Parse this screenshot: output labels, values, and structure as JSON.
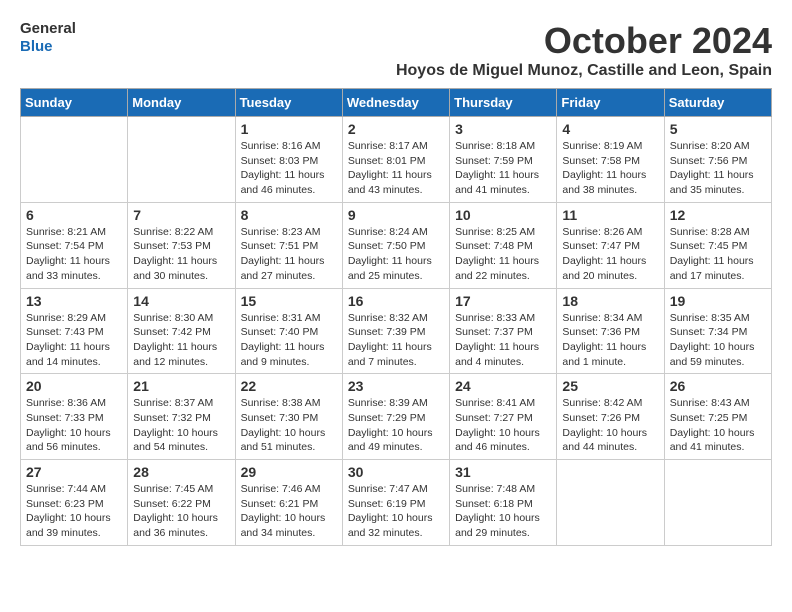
{
  "header": {
    "logo": {
      "line1": "General",
      "line2": "Blue"
    },
    "month_title": "October 2024",
    "subtitle": "Hoyos de Miguel Munoz, Castille and Leon, Spain"
  },
  "weekdays": [
    "Sunday",
    "Monday",
    "Tuesday",
    "Wednesday",
    "Thursday",
    "Friday",
    "Saturday"
  ],
  "weeks": [
    [
      {
        "day": "",
        "info": ""
      },
      {
        "day": "",
        "info": ""
      },
      {
        "day": "1",
        "info": "Sunrise: 8:16 AM\nSunset: 8:03 PM\nDaylight: 11 hours and 46 minutes."
      },
      {
        "day": "2",
        "info": "Sunrise: 8:17 AM\nSunset: 8:01 PM\nDaylight: 11 hours and 43 minutes."
      },
      {
        "day": "3",
        "info": "Sunrise: 8:18 AM\nSunset: 7:59 PM\nDaylight: 11 hours and 41 minutes."
      },
      {
        "day": "4",
        "info": "Sunrise: 8:19 AM\nSunset: 7:58 PM\nDaylight: 11 hours and 38 minutes."
      },
      {
        "day": "5",
        "info": "Sunrise: 8:20 AM\nSunset: 7:56 PM\nDaylight: 11 hours and 35 minutes."
      }
    ],
    [
      {
        "day": "6",
        "info": "Sunrise: 8:21 AM\nSunset: 7:54 PM\nDaylight: 11 hours and 33 minutes."
      },
      {
        "day": "7",
        "info": "Sunrise: 8:22 AM\nSunset: 7:53 PM\nDaylight: 11 hours and 30 minutes."
      },
      {
        "day": "8",
        "info": "Sunrise: 8:23 AM\nSunset: 7:51 PM\nDaylight: 11 hours and 27 minutes."
      },
      {
        "day": "9",
        "info": "Sunrise: 8:24 AM\nSunset: 7:50 PM\nDaylight: 11 hours and 25 minutes."
      },
      {
        "day": "10",
        "info": "Sunrise: 8:25 AM\nSunset: 7:48 PM\nDaylight: 11 hours and 22 minutes."
      },
      {
        "day": "11",
        "info": "Sunrise: 8:26 AM\nSunset: 7:47 PM\nDaylight: 11 hours and 20 minutes."
      },
      {
        "day": "12",
        "info": "Sunrise: 8:28 AM\nSunset: 7:45 PM\nDaylight: 11 hours and 17 minutes."
      }
    ],
    [
      {
        "day": "13",
        "info": "Sunrise: 8:29 AM\nSunset: 7:43 PM\nDaylight: 11 hours and 14 minutes."
      },
      {
        "day": "14",
        "info": "Sunrise: 8:30 AM\nSunset: 7:42 PM\nDaylight: 11 hours and 12 minutes."
      },
      {
        "day": "15",
        "info": "Sunrise: 8:31 AM\nSunset: 7:40 PM\nDaylight: 11 hours and 9 minutes."
      },
      {
        "day": "16",
        "info": "Sunrise: 8:32 AM\nSunset: 7:39 PM\nDaylight: 11 hours and 7 minutes."
      },
      {
        "day": "17",
        "info": "Sunrise: 8:33 AM\nSunset: 7:37 PM\nDaylight: 11 hours and 4 minutes."
      },
      {
        "day": "18",
        "info": "Sunrise: 8:34 AM\nSunset: 7:36 PM\nDaylight: 11 hours and 1 minute."
      },
      {
        "day": "19",
        "info": "Sunrise: 8:35 AM\nSunset: 7:34 PM\nDaylight: 10 hours and 59 minutes."
      }
    ],
    [
      {
        "day": "20",
        "info": "Sunrise: 8:36 AM\nSunset: 7:33 PM\nDaylight: 10 hours and 56 minutes."
      },
      {
        "day": "21",
        "info": "Sunrise: 8:37 AM\nSunset: 7:32 PM\nDaylight: 10 hours and 54 minutes."
      },
      {
        "day": "22",
        "info": "Sunrise: 8:38 AM\nSunset: 7:30 PM\nDaylight: 10 hours and 51 minutes."
      },
      {
        "day": "23",
        "info": "Sunrise: 8:39 AM\nSunset: 7:29 PM\nDaylight: 10 hours and 49 minutes."
      },
      {
        "day": "24",
        "info": "Sunrise: 8:41 AM\nSunset: 7:27 PM\nDaylight: 10 hours and 46 minutes."
      },
      {
        "day": "25",
        "info": "Sunrise: 8:42 AM\nSunset: 7:26 PM\nDaylight: 10 hours and 44 minutes."
      },
      {
        "day": "26",
        "info": "Sunrise: 8:43 AM\nSunset: 7:25 PM\nDaylight: 10 hours and 41 minutes."
      }
    ],
    [
      {
        "day": "27",
        "info": "Sunrise: 7:44 AM\nSunset: 6:23 PM\nDaylight: 10 hours and 39 minutes."
      },
      {
        "day": "28",
        "info": "Sunrise: 7:45 AM\nSunset: 6:22 PM\nDaylight: 10 hours and 36 minutes."
      },
      {
        "day": "29",
        "info": "Sunrise: 7:46 AM\nSunset: 6:21 PM\nDaylight: 10 hours and 34 minutes."
      },
      {
        "day": "30",
        "info": "Sunrise: 7:47 AM\nSunset: 6:19 PM\nDaylight: 10 hours and 32 minutes."
      },
      {
        "day": "31",
        "info": "Sunrise: 7:48 AM\nSunset: 6:18 PM\nDaylight: 10 hours and 29 minutes."
      },
      {
        "day": "",
        "info": ""
      },
      {
        "day": "",
        "info": ""
      }
    ]
  ]
}
